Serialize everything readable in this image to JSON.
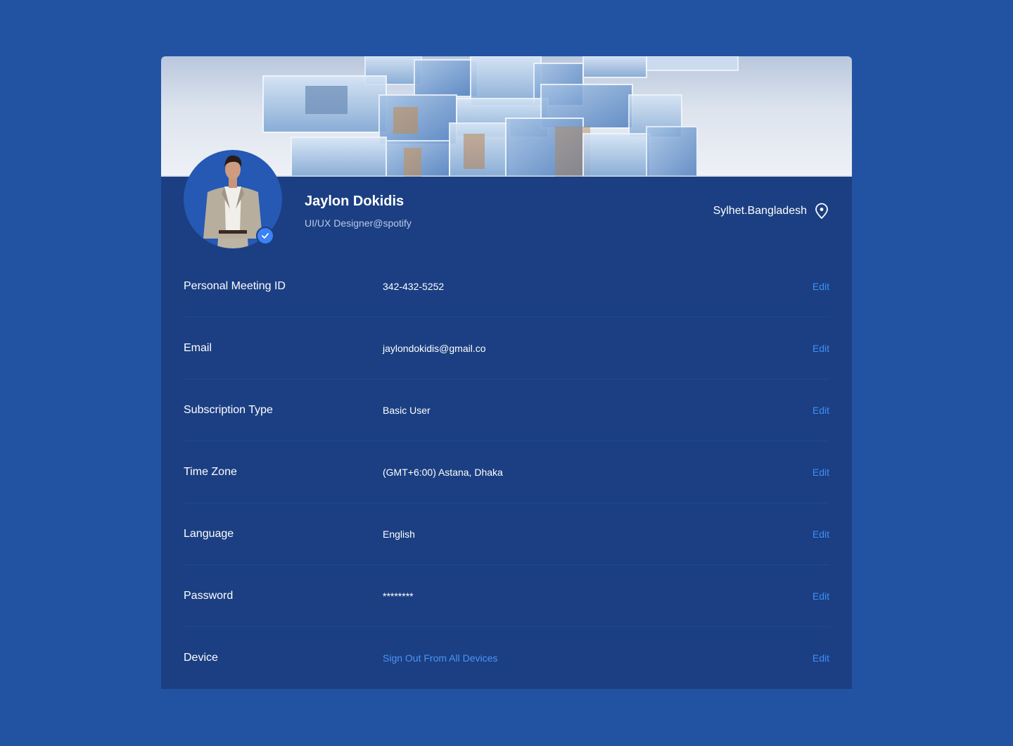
{
  "profile": {
    "name": "Jaylon Dokidis",
    "role": "UI/UX Designer@spotify",
    "location": "Sylhet.Bangladesh",
    "verified": true
  },
  "colors": {
    "page_background": "#2253a3",
    "card_background": "#1b3f82",
    "accent": "#3f8ef5"
  },
  "icons": {
    "location": "location-pin-icon",
    "verified": "check-badge-icon"
  },
  "rows": [
    {
      "label": "Personal Meeting ID",
      "value": "342-432-5252",
      "action": "Edit"
    },
    {
      "label": "Email",
      "value": "jaylondokidis@gmail.co",
      "action": "Edit"
    },
    {
      "label": "Subscription Type",
      "value": "Basic User",
      "action": "Edit"
    },
    {
      "label": "Time Zone",
      "value": "(GMT+6:00) Astana, Dhaka",
      "action": "Edit"
    },
    {
      "label": "Language",
      "value": "English",
      "action": "Edit"
    },
    {
      "label": "Password",
      "value": "********",
      "action": "Edit"
    },
    {
      "label": "Device",
      "value": "Sign Out From All Devices",
      "action": "Edit"
    }
  ]
}
